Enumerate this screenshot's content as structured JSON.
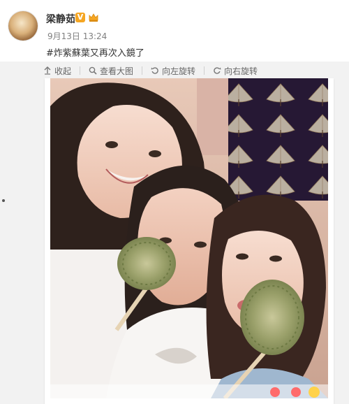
{
  "post": {
    "author_name": "梁静茹",
    "verified_badge": "V",
    "time": "9月13日 13:24",
    "text": "#炸紫蘇葉又再次入鏡了"
  },
  "toolbar": {
    "collapse": "收起",
    "view_large": "查看大图",
    "rotate_left": "向左旋转",
    "rotate_right": "向右旋转"
  },
  "colors": {
    "page_bg": "#ffffff",
    "panel_bg": "#f2f2f2",
    "text_primary": "#333333",
    "text_secondary": "#808080",
    "badge": "#f5a623"
  },
  "icons": [
    "collapse-icon",
    "magnifier-icon",
    "rotate-left-icon",
    "rotate-right-icon",
    "crown-icon"
  ]
}
